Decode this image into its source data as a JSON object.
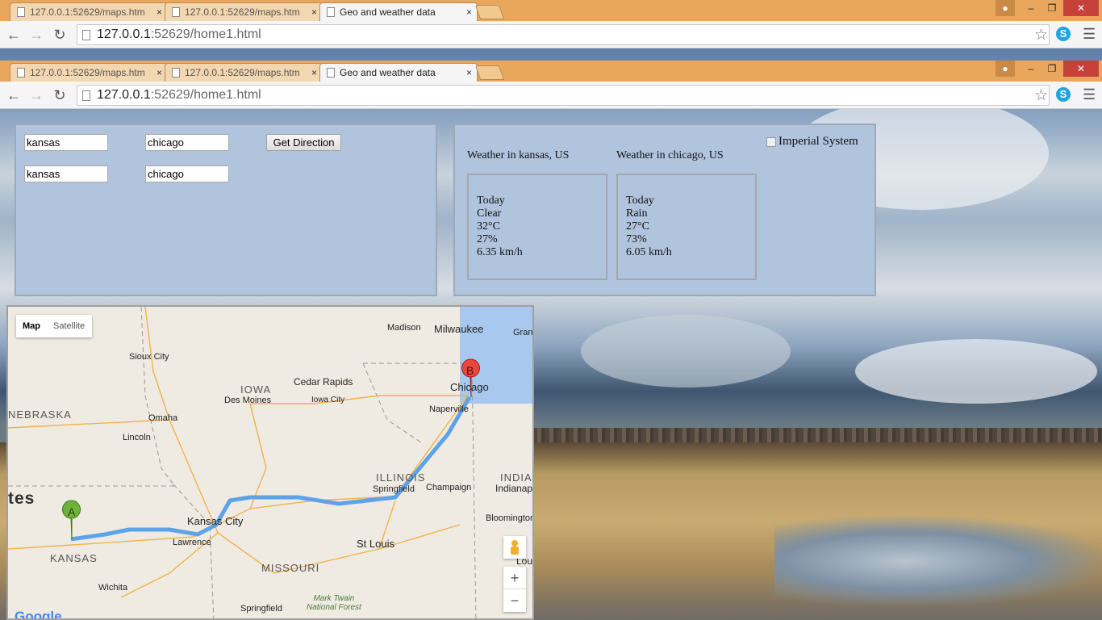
{
  "browser": {
    "tabs": [
      {
        "title": "127.0.0.1:52629/maps.htm",
        "active": false
      },
      {
        "title": "127.0.0.1:52629/maps.htm",
        "active": false
      },
      {
        "title": "Geo and weather data",
        "active": true
      }
    ],
    "url_host": "127.0.0.1",
    "url_rest": ":52629/home1.html",
    "close_glyph": "×"
  },
  "directions": {
    "origin_values": [
      "kansas",
      "kansas"
    ],
    "destination_values": [
      "chicago",
      "chicago"
    ],
    "button_label": "Get Direction"
  },
  "weather": {
    "imperial_label": "Imperial System",
    "imperial_checked": false,
    "cities": [
      {
        "heading": "Weather in kansas, US",
        "day": "Today",
        "condition": "Clear",
        "temp": "32°C",
        "humidity": "27%",
        "wind": "6.35 km/h"
      },
      {
        "heading": "Weather in chicago, US",
        "day": "Today",
        "condition": "Rain",
        "temp": "27°C",
        "humidity": "73%",
        "wind": "6.05 km/h"
      }
    ]
  },
  "map": {
    "type_buttons": [
      "Map",
      "Satellite"
    ],
    "markers": [
      "A",
      "B"
    ],
    "zoom_in": "+",
    "zoom_out": "−",
    "logo": "Google",
    "cities": {
      "madison": "Madison",
      "milwaukee": "Milwaukee",
      "gran": "Gran",
      "sioux": "Sioux City",
      "cedar": "Cedar Rapids",
      "desmoines": "Des Moines",
      "iowacity": "Iowa City",
      "chicago": "Chicago",
      "naperville": "Naperville",
      "omaha": "Omaha",
      "lincoln": "Lincoln",
      "springfield_il": "Springfield",
      "champaign": "Champaign",
      "indianap": "Indianap",
      "kansascity": "Kansas City",
      "lawrence": "Lawrence",
      "bloomington": "Bloomington",
      "stlouis": "St Louis",
      "lou": "Lou",
      "wichita": "Wichita",
      "springfield_mo": "Springfield",
      "marktwain": "Mark Twain\nNational Forest"
    },
    "states": {
      "iowa": "IOWA",
      "nebraska": "NEBRASKA",
      "illinois": "ILLINOIS",
      "india": "INDIA",
      "tes": "tes",
      "kansas": "KANSAS",
      "missouri": "MISSOURI"
    }
  },
  "colors": {
    "panel_bg": "#b0c4de",
    "tabbar": "#e8a75c",
    "route": "#5ea3e8",
    "marker_a": "#6fb23b",
    "marker_b": "#e8473b"
  }
}
